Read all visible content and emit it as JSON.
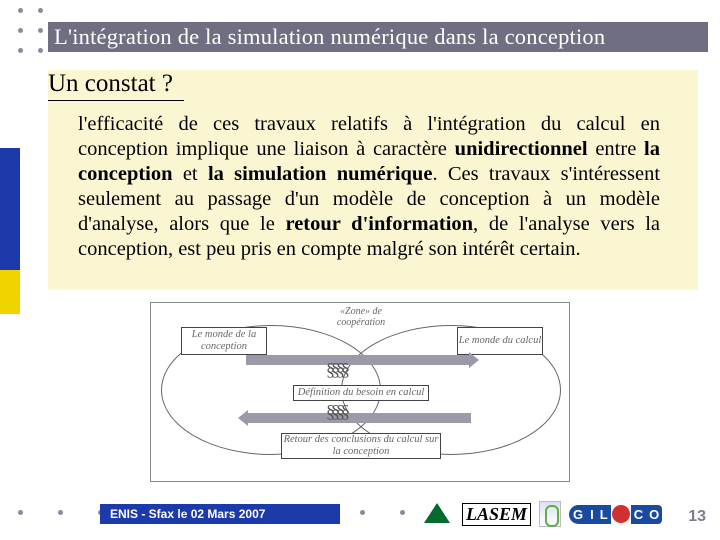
{
  "title": "L'intégration de la simulation numérique dans la conception",
  "subtitle": "Un constat ?",
  "body": "l'efficacité de ces travaux relatifs à l'intégration du calcul en conception implique une liaison à caractère <b>unidirectionnel</b> entre <b>la conception</b> et <b>la simulation numérique</b>. Ces travaux s'intéressent seulement au passage d'un modèle de conception à un modèle d'analyse, alors que le <b>retour d'information</b>, de l'analyse vers la conception, est peu pris en compte malgré son intérêt certain.",
  "diagram": {
    "left_box": "Le monde de la conception",
    "right_box": "Le monde du calcul",
    "zone_label": "«Zone» de coopération",
    "mid_label": "Définition du besoin en calcul",
    "bottom_label": "Retour des conclusions du calcul sur la conception"
  },
  "footer": {
    "strip": "ENIS - Sfax le 02 Mars 2007",
    "lasem": "LASEM",
    "gilco_parts": {
      "g": "G",
      "i": "I",
      "l": "L",
      "c": "C",
      "o": "O"
    }
  },
  "page_number": "13"
}
